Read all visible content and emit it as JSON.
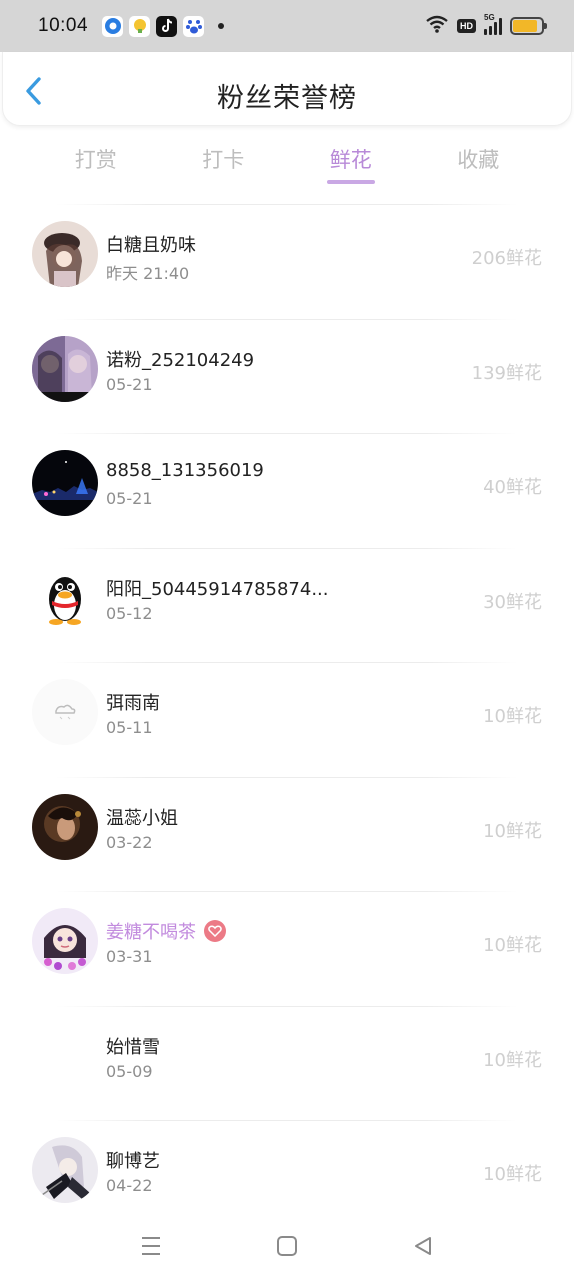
{
  "status_bar": {
    "time": "10:04",
    "network_label": "5G",
    "hd_label": "HD",
    "battery_level": 0.85,
    "battery_color": "#f2b728",
    "app_icons": [
      "browser-icon",
      "weather-app-icon",
      "tiktok-icon",
      "baidu-icon"
    ]
  },
  "header": {
    "title": "粉丝荣誉榜",
    "back_icon": "chevron-left-icon",
    "accent": "#3a9be0"
  },
  "tabs": [
    {
      "label": "打赏",
      "active": false
    },
    {
      "label": "打卡",
      "active": false
    },
    {
      "label": "鲜花",
      "active": true
    },
    {
      "label": "收藏",
      "active": false
    }
  ],
  "tab_active_color": "#b88ad8",
  "fans": [
    {
      "name": "白糖且奶味",
      "date": "昨天 21:40",
      "value": "206鲜花",
      "highlight": false
    },
    {
      "name": "诺粉_252104249",
      "date": "05-21",
      "value": "139鲜花",
      "highlight": false
    },
    {
      "name": "8858_131356019",
      "date": "05-21",
      "value": "40鲜花",
      "highlight": false
    },
    {
      "name": "阳阳_50445914785874...",
      "date": "05-12",
      "value": "30鲜花",
      "highlight": false
    },
    {
      "name": "弭雨南",
      "date": "05-11",
      "value": "10鲜花",
      "highlight": false
    },
    {
      "name": "温蕊小姐",
      "date": "03-22",
      "value": "10鲜花",
      "highlight": false
    },
    {
      "name": "姜糖不喝茶",
      "date": "03-31",
      "value": "10鲜花",
      "highlight": true
    },
    {
      "name": "始惜雪",
      "date": "05-09",
      "value": "10鲜花",
      "highlight": false
    },
    {
      "name": "聊博艺",
      "date": "04-22",
      "value": "10鲜花",
      "highlight": false
    }
  ],
  "navbar": {
    "icons": [
      "menu-icon",
      "home-square-icon",
      "back-triangle-icon"
    ]
  }
}
